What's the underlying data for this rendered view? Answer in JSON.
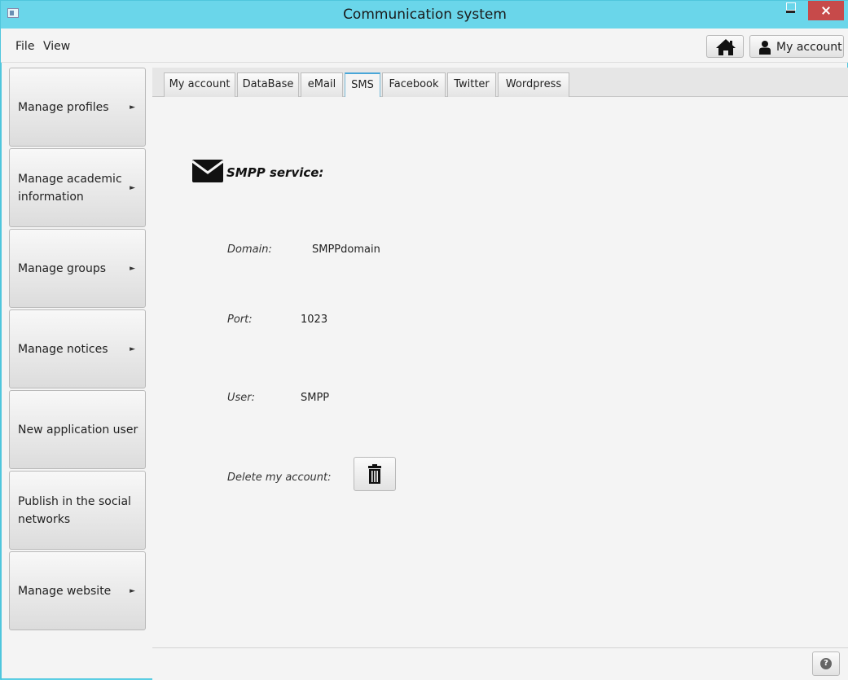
{
  "window": {
    "title": "Communication system"
  },
  "menubar": {
    "file_label": "File",
    "view_label": "View",
    "home_icon": "home-icon",
    "account_label": "My account"
  },
  "sidebar": {
    "items": [
      {
        "label": "Manage profiles",
        "has_arrow": true
      },
      {
        "label": "Manage academic information",
        "has_arrow": true
      },
      {
        "label": "Manage groups",
        "has_arrow": true
      },
      {
        "label": "Manage notices",
        "has_arrow": true
      },
      {
        "label": "New application user",
        "has_arrow": false
      },
      {
        "label": "Publish in the social networks",
        "has_arrow": false
      },
      {
        "label": "Manage website",
        "has_arrow": true
      }
    ],
    "arrow_glyph": "►"
  },
  "tabs": [
    {
      "label": "My account"
    },
    {
      "label": "DataBase"
    },
    {
      "label": "eMail"
    },
    {
      "label": "SMS",
      "active": true
    },
    {
      "label": "Facebook"
    },
    {
      "label": "Twitter"
    },
    {
      "label": "Wordpress"
    }
  ],
  "sms": {
    "heading": "SMPP service:",
    "domain_label": "Domain:",
    "domain_value": "SMPPdomain",
    "port_label": "Port:",
    "port_value": "1023",
    "user_label": "User:",
    "user_value": "SMPP",
    "delete_label": "Delete my account:"
  },
  "colors": {
    "titlebar": "#6ad6ea",
    "close": "#c74a4a",
    "active_tab_accent": "#48a6d8"
  }
}
